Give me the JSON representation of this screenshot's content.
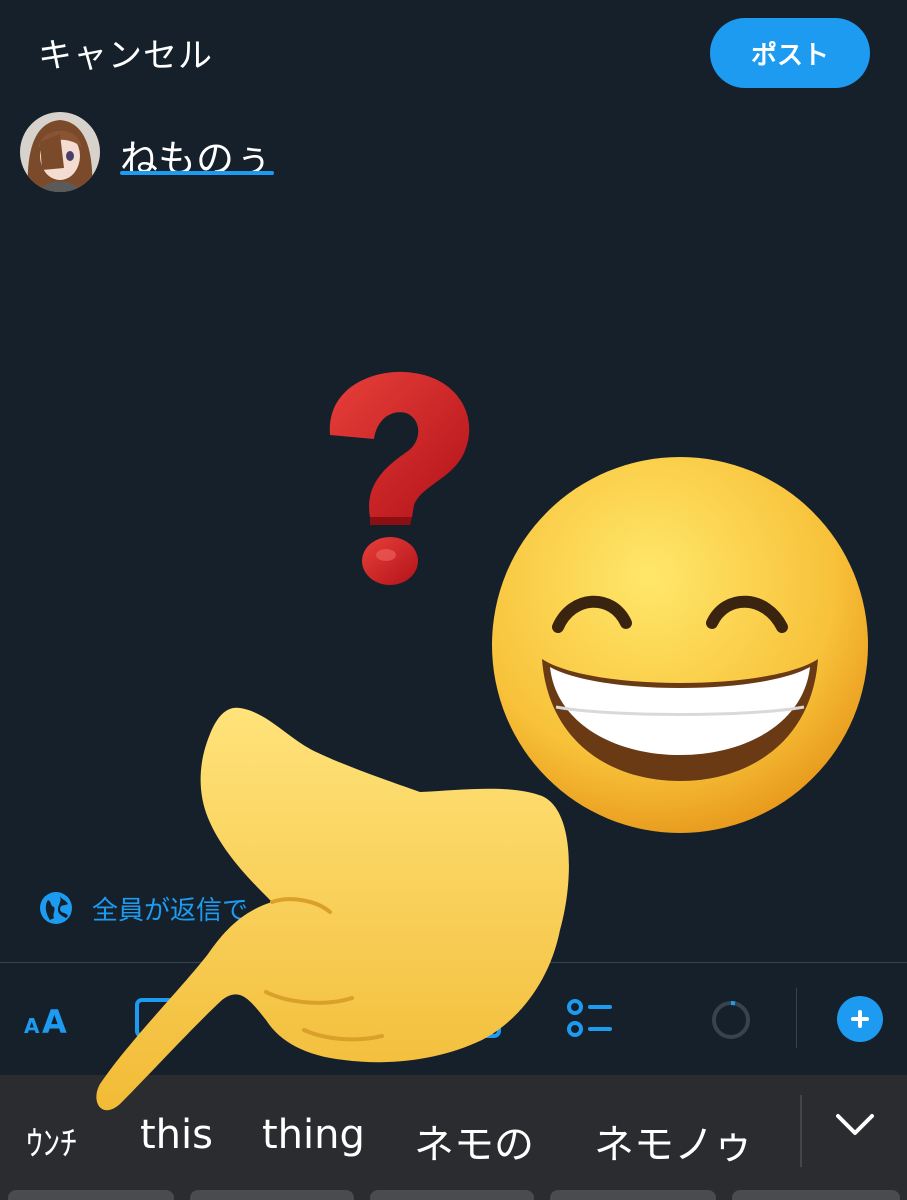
{
  "header": {
    "cancel_label": "キャンセル",
    "post_label": "ポスト"
  },
  "compose": {
    "text": "ねものぅ"
  },
  "reply_setting": {
    "label": "全員が返信で"
  },
  "toolbar": {
    "text_format_label": "AA",
    "icons": [
      "text-format-icon",
      "image-icon",
      "gif-icon",
      "poll-icon",
      "character-count-icon",
      "add-thread-icon"
    ]
  },
  "keyboard": {
    "suggestions": [
      "ｳﾝﾁ",
      "this",
      "thing",
      "ネモの",
      "ネモノゥ"
    ]
  },
  "colors": {
    "background": "#15202b",
    "accent": "#1d9bf0",
    "keyboard": "#2b2c2f"
  }
}
